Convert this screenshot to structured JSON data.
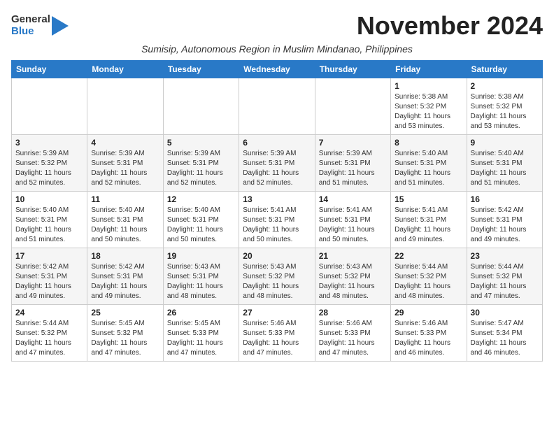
{
  "logo": {
    "general": "General",
    "blue": "Blue"
  },
  "header": {
    "month": "November 2024",
    "subtitle": "Sumisip, Autonomous Region in Muslim Mindanao, Philippines"
  },
  "columns": [
    "Sunday",
    "Monday",
    "Tuesday",
    "Wednesday",
    "Thursday",
    "Friday",
    "Saturday"
  ],
  "weeks": [
    [
      {
        "day": "",
        "info": ""
      },
      {
        "day": "",
        "info": ""
      },
      {
        "day": "",
        "info": ""
      },
      {
        "day": "",
        "info": ""
      },
      {
        "day": "",
        "info": ""
      },
      {
        "day": "1",
        "info": "Sunrise: 5:38 AM\nSunset: 5:32 PM\nDaylight: 11 hours and 53 minutes."
      },
      {
        "day": "2",
        "info": "Sunrise: 5:38 AM\nSunset: 5:32 PM\nDaylight: 11 hours and 53 minutes."
      }
    ],
    [
      {
        "day": "3",
        "info": "Sunrise: 5:39 AM\nSunset: 5:32 PM\nDaylight: 11 hours and 52 minutes."
      },
      {
        "day": "4",
        "info": "Sunrise: 5:39 AM\nSunset: 5:31 PM\nDaylight: 11 hours and 52 minutes."
      },
      {
        "day": "5",
        "info": "Sunrise: 5:39 AM\nSunset: 5:31 PM\nDaylight: 11 hours and 52 minutes."
      },
      {
        "day": "6",
        "info": "Sunrise: 5:39 AM\nSunset: 5:31 PM\nDaylight: 11 hours and 52 minutes."
      },
      {
        "day": "7",
        "info": "Sunrise: 5:39 AM\nSunset: 5:31 PM\nDaylight: 11 hours and 51 minutes."
      },
      {
        "day": "8",
        "info": "Sunrise: 5:40 AM\nSunset: 5:31 PM\nDaylight: 11 hours and 51 minutes."
      },
      {
        "day": "9",
        "info": "Sunrise: 5:40 AM\nSunset: 5:31 PM\nDaylight: 11 hours and 51 minutes."
      }
    ],
    [
      {
        "day": "10",
        "info": "Sunrise: 5:40 AM\nSunset: 5:31 PM\nDaylight: 11 hours and 51 minutes."
      },
      {
        "day": "11",
        "info": "Sunrise: 5:40 AM\nSunset: 5:31 PM\nDaylight: 11 hours and 50 minutes."
      },
      {
        "day": "12",
        "info": "Sunrise: 5:40 AM\nSunset: 5:31 PM\nDaylight: 11 hours and 50 minutes."
      },
      {
        "day": "13",
        "info": "Sunrise: 5:41 AM\nSunset: 5:31 PM\nDaylight: 11 hours and 50 minutes."
      },
      {
        "day": "14",
        "info": "Sunrise: 5:41 AM\nSunset: 5:31 PM\nDaylight: 11 hours and 50 minutes."
      },
      {
        "day": "15",
        "info": "Sunrise: 5:41 AM\nSunset: 5:31 PM\nDaylight: 11 hours and 49 minutes."
      },
      {
        "day": "16",
        "info": "Sunrise: 5:42 AM\nSunset: 5:31 PM\nDaylight: 11 hours and 49 minutes."
      }
    ],
    [
      {
        "day": "17",
        "info": "Sunrise: 5:42 AM\nSunset: 5:31 PM\nDaylight: 11 hours and 49 minutes."
      },
      {
        "day": "18",
        "info": "Sunrise: 5:42 AM\nSunset: 5:31 PM\nDaylight: 11 hours and 49 minutes."
      },
      {
        "day": "19",
        "info": "Sunrise: 5:43 AM\nSunset: 5:31 PM\nDaylight: 11 hours and 48 minutes."
      },
      {
        "day": "20",
        "info": "Sunrise: 5:43 AM\nSunset: 5:32 PM\nDaylight: 11 hours and 48 minutes."
      },
      {
        "day": "21",
        "info": "Sunrise: 5:43 AM\nSunset: 5:32 PM\nDaylight: 11 hours and 48 minutes."
      },
      {
        "day": "22",
        "info": "Sunrise: 5:44 AM\nSunset: 5:32 PM\nDaylight: 11 hours and 48 minutes."
      },
      {
        "day": "23",
        "info": "Sunrise: 5:44 AM\nSunset: 5:32 PM\nDaylight: 11 hours and 47 minutes."
      }
    ],
    [
      {
        "day": "24",
        "info": "Sunrise: 5:44 AM\nSunset: 5:32 PM\nDaylight: 11 hours and 47 minutes."
      },
      {
        "day": "25",
        "info": "Sunrise: 5:45 AM\nSunset: 5:32 PM\nDaylight: 11 hours and 47 minutes."
      },
      {
        "day": "26",
        "info": "Sunrise: 5:45 AM\nSunset: 5:33 PM\nDaylight: 11 hours and 47 minutes."
      },
      {
        "day": "27",
        "info": "Sunrise: 5:46 AM\nSunset: 5:33 PM\nDaylight: 11 hours and 47 minutes."
      },
      {
        "day": "28",
        "info": "Sunrise: 5:46 AM\nSunset: 5:33 PM\nDaylight: 11 hours and 47 minutes."
      },
      {
        "day": "29",
        "info": "Sunrise: 5:46 AM\nSunset: 5:33 PM\nDaylight: 11 hours and 46 minutes."
      },
      {
        "day": "30",
        "info": "Sunrise: 5:47 AM\nSunset: 5:34 PM\nDaylight: 11 hours and 46 minutes."
      }
    ]
  ]
}
